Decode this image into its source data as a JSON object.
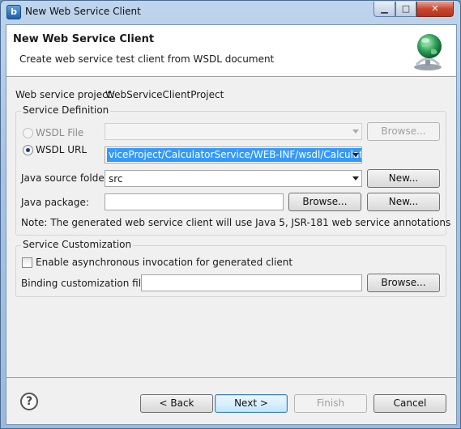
{
  "window": {
    "title": "New Web Service Client",
    "icon": "app-b-icon",
    "icon_glyph": "b"
  },
  "header": {
    "title": "New Web Service Client",
    "description": "Create web service test client from WSDL document",
    "icon": "web-service-globe-icon"
  },
  "project": {
    "label": "Web service project:",
    "value": "WebServiceClientProject"
  },
  "service_definition": {
    "title": "Service Definition",
    "wsdl_file": {
      "label": "WSDL File",
      "selected": false,
      "enabled": false,
      "browse_label": "Browse..."
    },
    "wsdl_url": {
      "label": "WSDL URL",
      "selected": true,
      "value": "viceProject/CalculatorService/WEB-INF/wsdl/Calculator"
    },
    "java_source_folder": {
      "label": "Java source folder:",
      "value": "src",
      "new_label": "New..."
    },
    "java_package": {
      "label": "Java package:",
      "value": "",
      "browse_label": "Browse...",
      "new_label": "New..."
    },
    "note": "Note: The generated web service client will use Java 5, JSR-181 web service annotations"
  },
  "service_customization": {
    "title": "Service Customization",
    "async": {
      "label": "Enable asynchronous invocation for generated client",
      "checked": false
    },
    "binding": {
      "label": "Binding customization file:",
      "value": "",
      "browse_label": "Browse..."
    }
  },
  "footer": {
    "help_glyph": "?",
    "back_label": "< Back",
    "next_label": "Next >",
    "finish_label": "Finish",
    "cancel_label": "Cancel"
  },
  "colors": {
    "selection": "#3399ff",
    "default_button_border": "#3c7fb1",
    "title_bar": "#a8c3e3"
  }
}
